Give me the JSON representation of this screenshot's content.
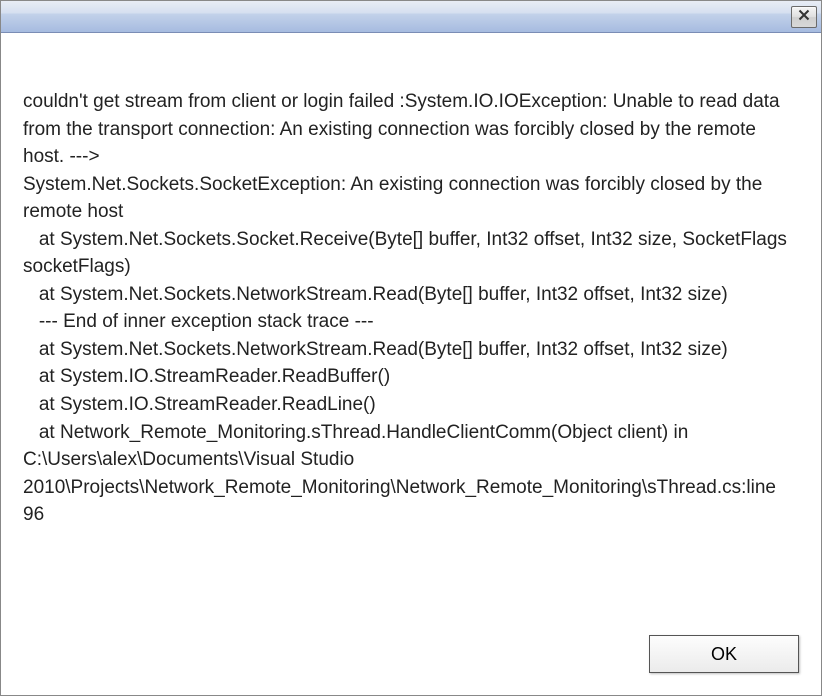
{
  "dialog": {
    "message": "couldn't get stream from client or login failed :System.IO.IOException: Unable to read data from the transport connection: An existing connection was forcibly closed by the remote host. --->\nSystem.Net.Sockets.SocketException: An existing connection was forcibly closed by the remote host\n   at System.Net.Sockets.Socket.Receive(Byte[] buffer, Int32 offset, Int32 size, SocketFlags socketFlags)\n   at System.Net.Sockets.NetworkStream.Read(Byte[] buffer, Int32 offset, Int32 size)\n   --- End of inner exception stack trace ---\n   at System.Net.Sockets.NetworkStream.Read(Byte[] buffer, Int32 offset, Int32 size)\n   at System.IO.StreamReader.ReadBuffer()\n   at System.IO.StreamReader.ReadLine()\n   at Network_Remote_Monitoring.sThread.HandleClientComm(Object client) in C:\\Users\\alex\\Documents\\Visual Studio 2010\\Projects\\Network_Remote_Monitoring\\Network_Remote_Monitoring\\sThread.cs:line 96",
    "ok_label": "OK"
  }
}
